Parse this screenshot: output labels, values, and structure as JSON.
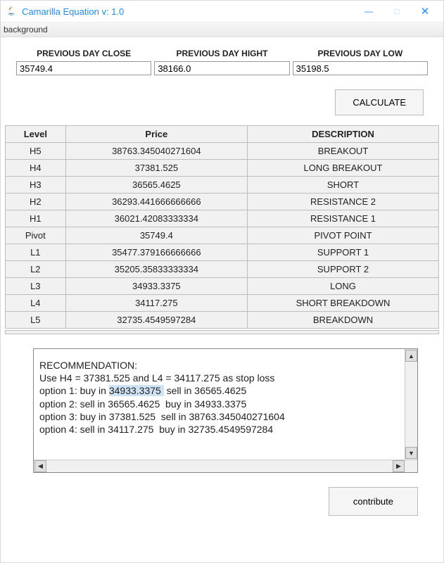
{
  "window": {
    "title": "Camarilla Equation v: 1.0"
  },
  "menu": {
    "background": "background"
  },
  "inputs": {
    "close_label": "PREVIOUS DAY CLOSE",
    "high_label": "PREVIOUS DAY HIGHT",
    "low_label": "PREVIOUS DAY LOW",
    "close_value": "35749.4",
    "high_value": "38166.0",
    "low_value": "35198.5"
  },
  "buttons": {
    "calculate": "CALCULATE",
    "contribute": "contribute"
  },
  "table": {
    "headers": {
      "level": "Level",
      "price": "Price",
      "desc": "DESCRIPTION"
    },
    "rows": [
      {
        "level": "H5",
        "price": "38763.345040271604",
        "desc": "BREAKOUT"
      },
      {
        "level": "H4",
        "price": "37381.525",
        "desc": "LONG BREAKOUT"
      },
      {
        "level": "H3",
        "price": "36565.4625",
        "desc": "SHORT"
      },
      {
        "level": "H2",
        "price": "36293.441666666666",
        "desc": "RESISTANCE 2"
      },
      {
        "level": "H1",
        "price": "36021.42083333334",
        "desc": "RESISTANCE 1"
      },
      {
        "level": "Pivot",
        "price": "35749.4",
        "desc": "PIVOT POINT"
      },
      {
        "level": "L1",
        "price": "35477.379166666666",
        "desc": "SUPPORT 1"
      },
      {
        "level": "L2",
        "price": "35205.35833333334",
        "desc": "SUPPORT 2"
      },
      {
        "level": "L3",
        "price": "34933.3375",
        "desc": "LONG"
      },
      {
        "level": "L4",
        "price": "34117.275",
        "desc": "SHORT BREAKDOWN"
      },
      {
        "level": "L5",
        "price": "32735.4549597284",
        "desc": "BREAKDOWN"
      }
    ]
  },
  "reco": {
    "header": "RECOMMENDATION:",
    "line1a": "Use H4 = 37381.525 and L4 = 34117.275 as stop loss",
    "line2_pre": "option 1: buy in ",
    "line2_sel": "34933.3375 ",
    "line2_post": " sell in 36565.4625",
    "line3": "option 2: sell in 36565.4625  buy in 34933.3375",
    "line4": "option 3: buy in 37381.525  sell in 38763.345040271604",
    "line5": "option 4: sell in 34117.275  buy in 32735.4549597284"
  }
}
